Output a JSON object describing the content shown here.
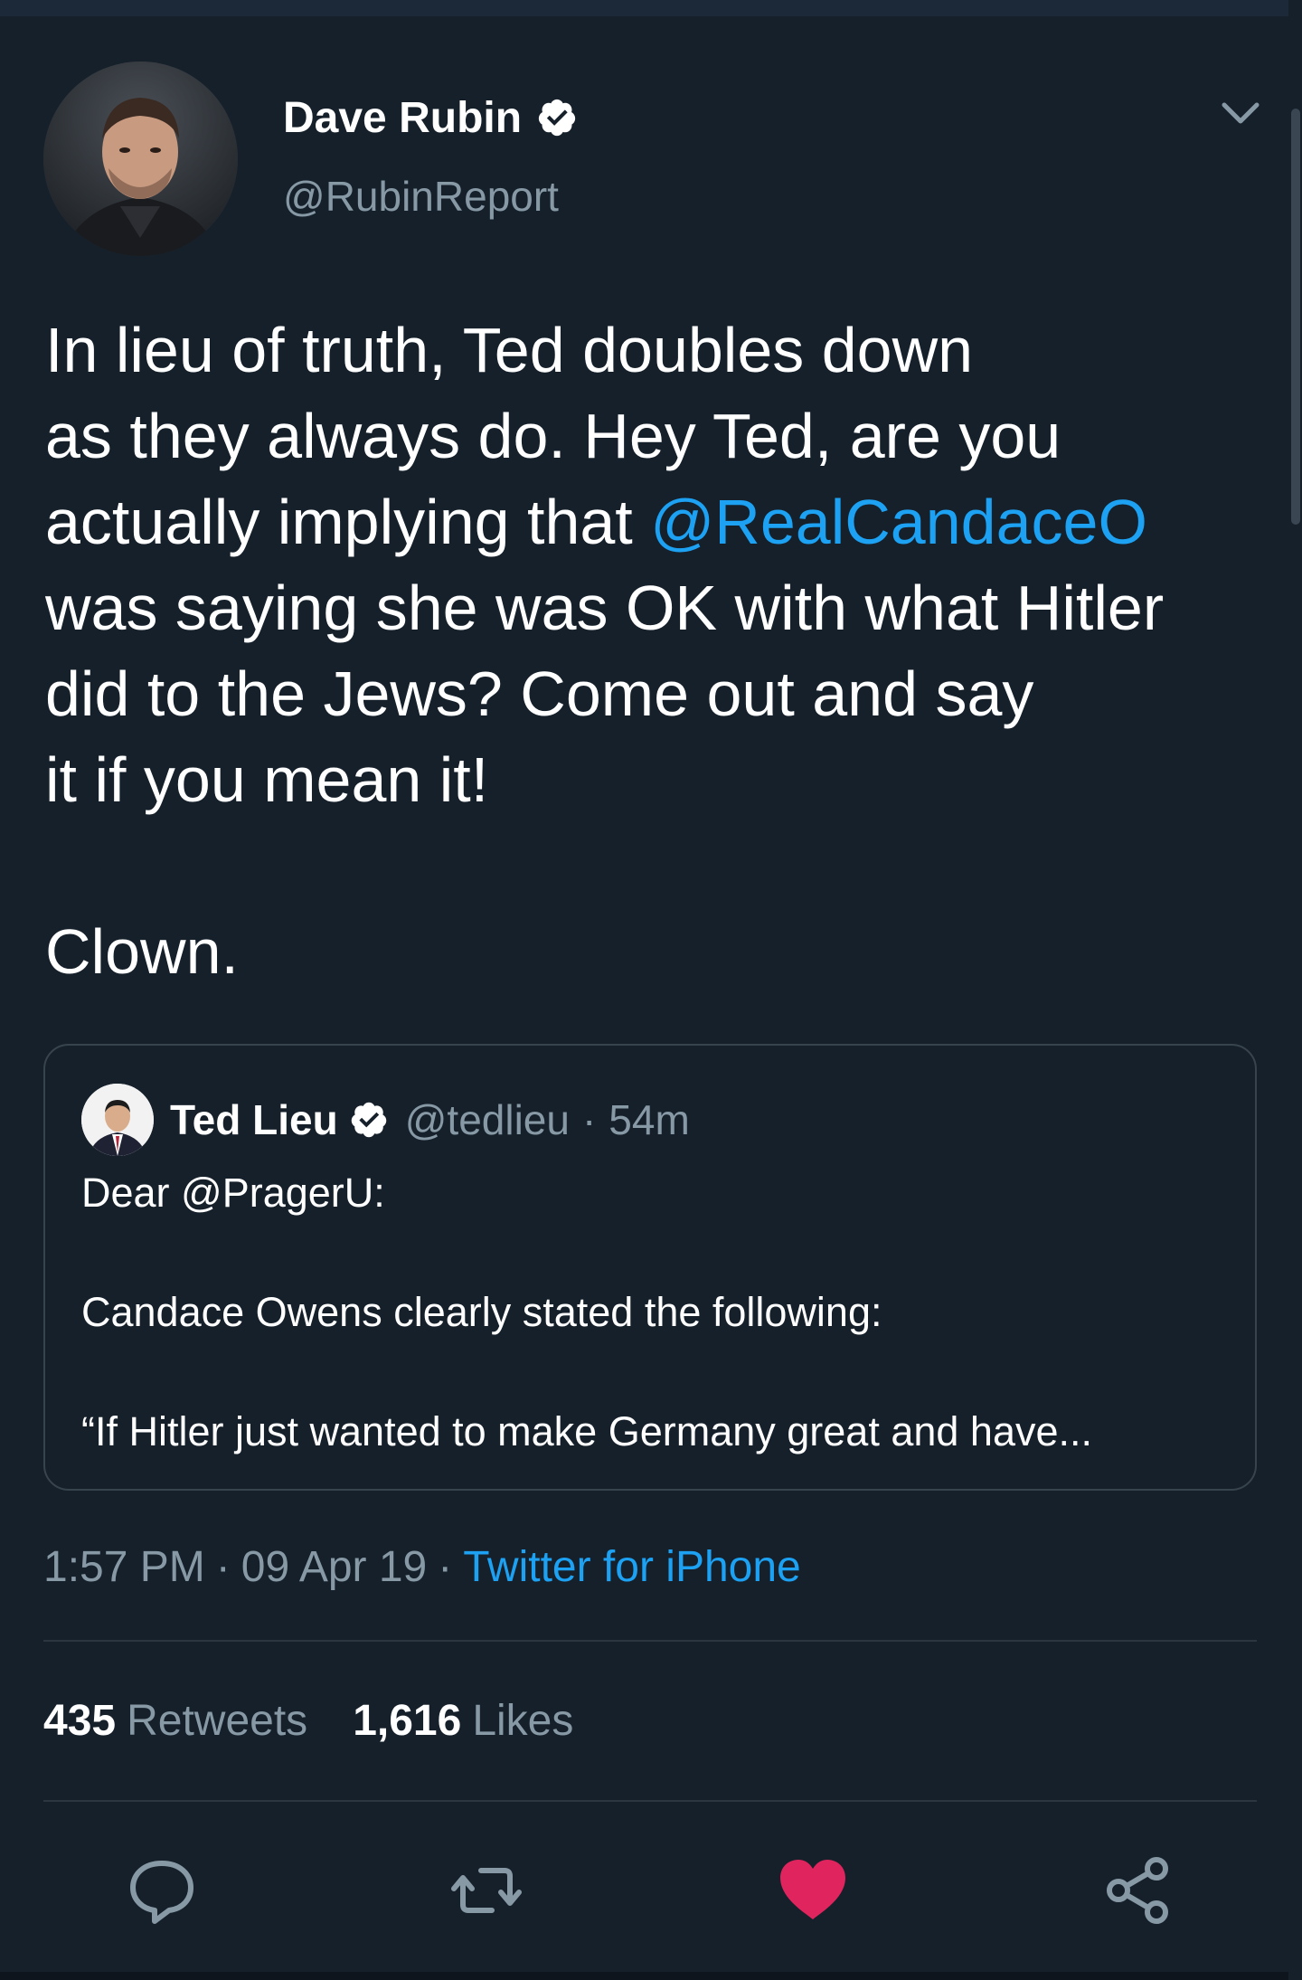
{
  "tweet": {
    "author": {
      "name": "Dave Rubin",
      "handle": "@RubinReport",
      "verified": true
    },
    "text_lines": [
      "In lieu of truth, Ted doubles down",
      "as they always do. Hey Ted, are you",
      "actually implying that ",
      "was saying she was OK with what Hitler",
      "did to the Jews? Come out and say",
      "it if you mean it!"
    ],
    "mention": "@RealCandaceO",
    "closing": "Clown.",
    "quoted": {
      "name": "Ted Lieu",
      "handle": "@tedlieu",
      "separator": "·",
      "time": "54m",
      "lines": [
        "Dear @PragerU:",
        "Candace Owens clearly stated the following:",
        "“If Hitler just wanted to make Germany great and have..."
      ]
    },
    "meta": {
      "time": "1:57 PM",
      "separator": "·",
      "date": "09 Apr 19",
      "source": "Twitter for iPhone"
    },
    "stats": {
      "retweets_count": "435",
      "retweets_label": "Retweets",
      "likes_count": "1,616",
      "likes_label": "Likes"
    },
    "actions": {
      "reply_icon": "reply-icon",
      "retweet_icon": "retweet-icon",
      "like_icon": "heart-icon",
      "share_icon": "share-icon",
      "liked": true
    }
  },
  "colors": {
    "background": "#15202b",
    "text": "#ffffff",
    "secondary": "#8899a6",
    "accent": "#1da1f2",
    "like": "#e0245e",
    "border": "#38444d"
  }
}
